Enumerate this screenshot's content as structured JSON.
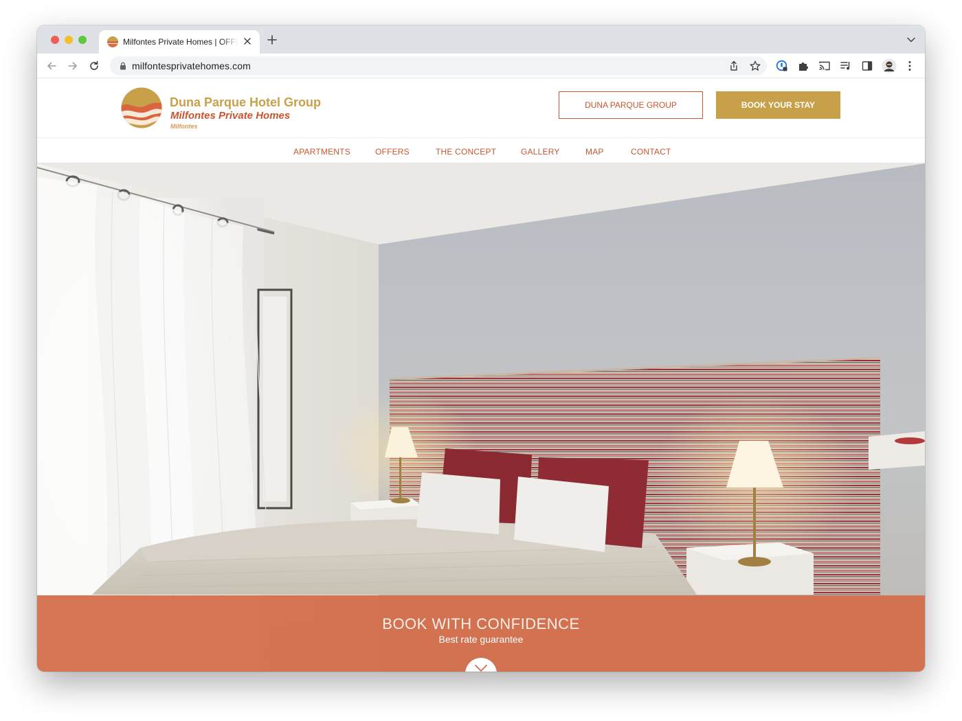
{
  "browser": {
    "tab_title": "Milfontes Private Homes | OFFICIAL SITE",
    "url": "milfontesprivatehomes.com"
  },
  "site": {
    "brand_group": "Duna Parque Hotel Group",
    "brand_name": "Milfontes Private Homes",
    "brand_location": "Milfontes",
    "group_button": "DUNA PARQUE GROUP",
    "book_button": "BOOK YOUR STAY",
    "nav": [
      "APARTMENTS",
      "OFFERS",
      "THE CONCEPT",
      "GALLERY",
      "MAP",
      "CONTACT"
    ]
  },
  "hero": {
    "banner_title": "BOOK WITH CONFIDENCE",
    "banner_subtitle": "Best rate guarantee"
  },
  "colors": {
    "gold": "#c9a04a",
    "terracotta": "#c8552f",
    "banner": "#d36d4a"
  }
}
